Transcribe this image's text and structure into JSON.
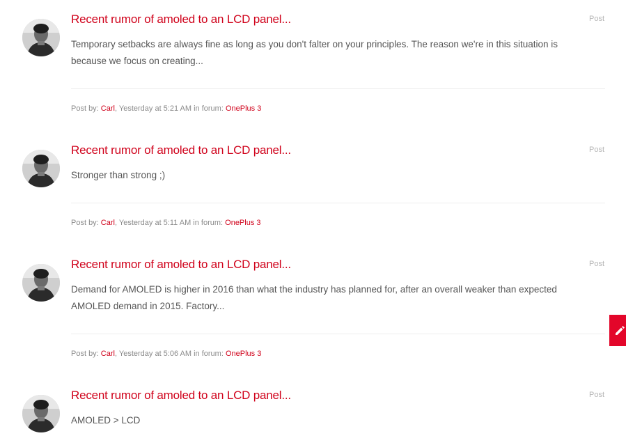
{
  "posts": [
    {
      "title": "Recent rumor of amoled to an LCD panel...",
      "type": "Post",
      "snippet": "Temporary setbacks are always fine as long as you don't falter on your principles. The reason we're in this situation is because we focus on creating...",
      "meta": {
        "prefix": "Post by: ",
        "author": "Carl",
        "time": ", Yesterday at 5:21 AM in forum: ",
        "forum": "OnePlus 3"
      }
    },
    {
      "title": "Recent rumor of amoled to an LCD panel...",
      "type": "Post",
      "snippet": "Stronger than strong ;)",
      "meta": {
        "prefix": "Post by: ",
        "author": "Carl",
        "time": ", Yesterday at 5:11 AM in forum: ",
        "forum": "OnePlus 3"
      }
    },
    {
      "title": "Recent rumor of amoled to an LCD panel...",
      "type": "Post",
      "snippet": "Demand for AMOLED is higher in 2016 than what the industry has planned for, after an overall weaker than expected AMOLED demand in 2015. Factory...",
      "meta": {
        "prefix": "Post by: ",
        "author": "Carl",
        "time": ", Yesterday at 5:06 AM in forum: ",
        "forum": "OnePlus 3"
      }
    },
    {
      "title": "Recent rumor of amoled to an LCD panel...",
      "type": "Post",
      "snippet": "AMOLED > LCD"
    }
  ],
  "colors": {
    "accent": "#d0021b",
    "fab": "#e3062a",
    "text": "#555555",
    "meta": "#8a8a8a"
  },
  "icons": {
    "avatar": "user-avatar-photo",
    "fab": "pencil-icon"
  }
}
